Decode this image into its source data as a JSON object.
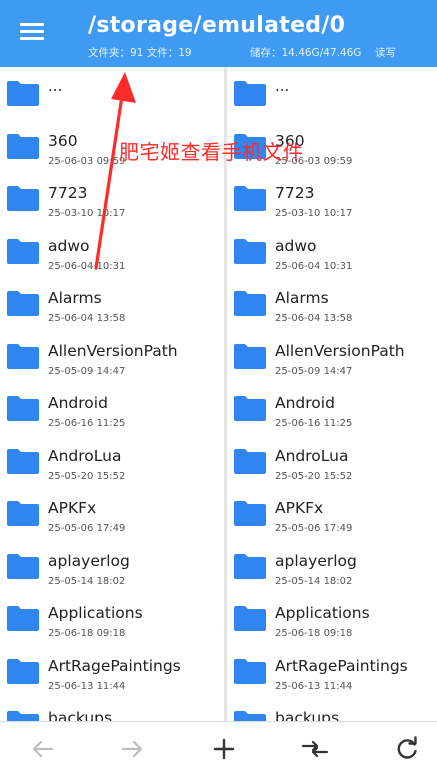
{
  "header": {
    "path": "/storage/emulated/0",
    "folders_label": "文件夹：91 文件：19",
    "storage_label": "储存：14.46G/47.46G",
    "rw_label": "读写",
    "accent_color": "#3f9af4"
  },
  "annotation": {
    "text": "肥宅姬查看手机文件",
    "color": "#ff2a2a"
  },
  "left_pane": {
    "items": [
      {
        "name": "...",
        "date": ""
      },
      {
        "name": "360",
        "date": "25-06-03 09:59"
      },
      {
        "name": "7723",
        "date": "25-03-10 10:17"
      },
      {
        "name": "adwo",
        "date": "25-06-04 10:31"
      },
      {
        "name": "Alarms",
        "date": "25-06-04 13:58"
      },
      {
        "name": "AllenVersionPath",
        "date": "25-05-09 14:47"
      },
      {
        "name": "Android",
        "date": "25-06-16 11:25"
      },
      {
        "name": "AndroLua",
        "date": "25-05-20 15:52"
      },
      {
        "name": "APKFx",
        "date": "25-05-06 17:49"
      },
      {
        "name": "aplayerlog",
        "date": "25-05-14 18:02"
      },
      {
        "name": "Applications",
        "date": "25-06-18 09:18"
      },
      {
        "name": "ArtRagePaintings",
        "date": "25-06-13 11:44"
      },
      {
        "name": "backups",
        "date": ""
      }
    ]
  },
  "right_pane": {
    "items": [
      {
        "name": "...",
        "date": ""
      },
      {
        "name": "360",
        "date": "25-06-03 09:59"
      },
      {
        "name": "7723",
        "date": "25-03-10 10:17"
      },
      {
        "name": "adwo",
        "date": "25-06-04 10:31"
      },
      {
        "name": "Alarms",
        "date": "25-06-04 13:58"
      },
      {
        "name": "AllenVersionPath",
        "date": "25-05-09 14:47"
      },
      {
        "name": "Android",
        "date": "25-06-16 11:25"
      },
      {
        "name": "AndroLua",
        "date": "25-05-20 15:52"
      },
      {
        "name": "APKFx",
        "date": "25-05-06 17:49"
      },
      {
        "name": "aplayerlog",
        "date": "25-05-14 18:02"
      },
      {
        "name": "Applications",
        "date": "25-06-18 09:18"
      },
      {
        "name": "ArtRagePaintings",
        "date": "25-06-13 11:44"
      },
      {
        "name": "backups",
        "date": ""
      }
    ]
  },
  "bottombar": {
    "icons": [
      "arrow-left-icon",
      "arrow-right-icon",
      "plus-icon",
      "swap-icon",
      "refresh-icon"
    ]
  },
  "colors": {
    "folder": "#2f86f0",
    "folder_tab": "#5aa3f5",
    "disabled_icon": "#b8b8b8",
    "active_icon": "#333333"
  }
}
